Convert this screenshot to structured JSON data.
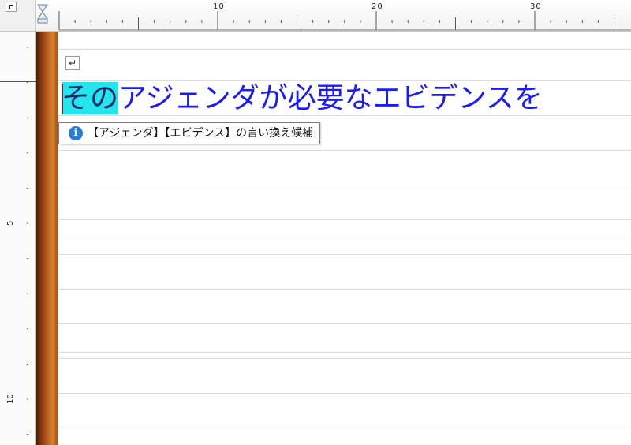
{
  "ruler": {
    "h_labels": [
      "10",
      "20",
      "30"
    ],
    "v_labels": [
      "5",
      "10"
    ]
  },
  "icons": {
    "corner": "tab-selector-icon",
    "indent": "indent-marker-icon",
    "paragraph": "return-mark-icon",
    "info": "info-icon"
  },
  "document": {
    "return_mark": "↵",
    "highlighted_text": "その",
    "text_rest": "アジェンダが必要なエビデンスを"
  },
  "tooltip": {
    "info_glyph": "i",
    "text": "【アジェンダ】【エビデンス】の言い換え候補"
  },
  "colors": {
    "highlight": "#22e5ee",
    "text": "#1a1aff",
    "margin_bar": "#c0661f",
    "info": "#2c7ad6"
  }
}
